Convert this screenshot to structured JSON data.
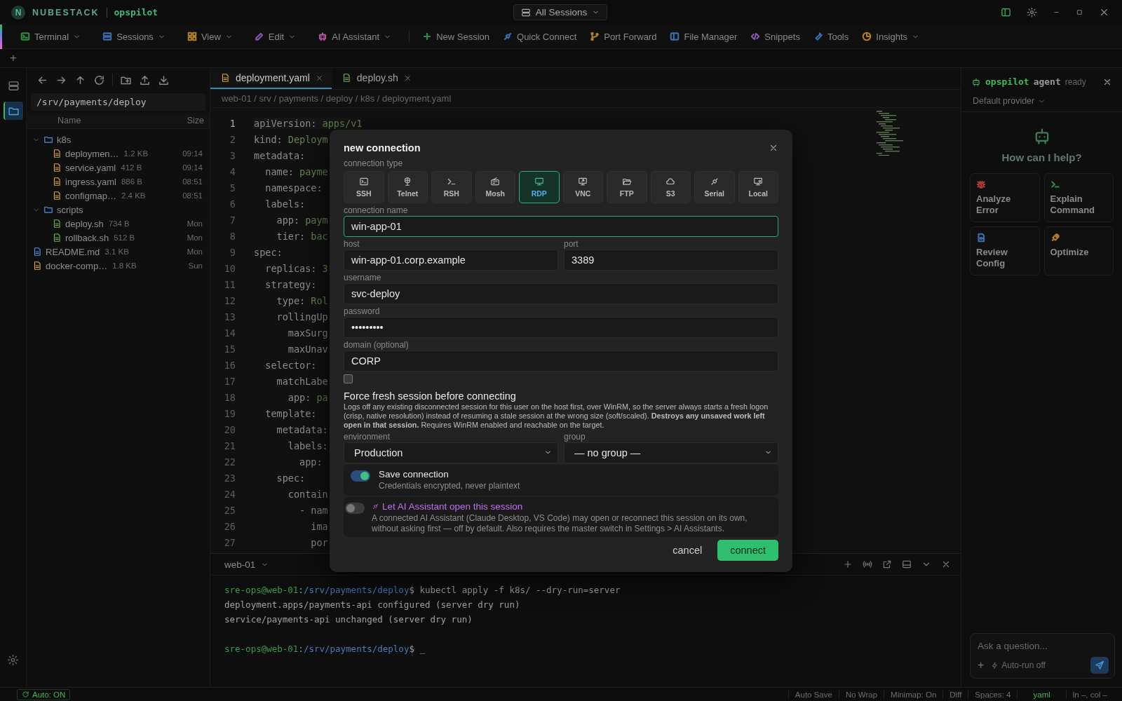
{
  "title_bar": {
    "logo_mark": "N",
    "brand": "NUBESTACK",
    "product": "opspilot",
    "session_switcher": "All Sessions"
  },
  "menu_bar": [
    {
      "label": "Terminal",
      "kind": "menu",
      "dropdown": true,
      "color": "#2e8a45"
    },
    {
      "label": "Sessions",
      "kind": "menu",
      "dropdown": true,
      "color": "#3a6eb0"
    },
    {
      "label": "View",
      "kind": "menu",
      "dropdown": true,
      "color": "#b07e25"
    },
    {
      "label": "Edit",
      "kind": "menu",
      "dropdown": true,
      "color": "#8a56b0"
    },
    {
      "label": "AI Assistant",
      "kind": "menu",
      "dropdown": true,
      "color": "#b055a5"
    },
    {
      "label": "New Session",
      "kind": "action",
      "dropdown": false,
      "color": "#2e8a45"
    },
    {
      "label": "Quick Connect",
      "kind": "action",
      "dropdown": false,
      "color": "#3a6eb0"
    },
    {
      "label": "Port Forward",
      "kind": "action",
      "dropdown": false,
      "color": "#b07e25"
    },
    {
      "label": "File Manager",
      "kind": "action",
      "dropdown": false,
      "color": "#3a6eb0"
    },
    {
      "label": "Snippets",
      "kind": "action",
      "dropdown": false,
      "color": "#8a56b0"
    },
    {
      "label": "Tools",
      "kind": "action",
      "dropdown": false,
      "color": "#3a6eb0"
    },
    {
      "label": "Insights",
      "kind": "action",
      "dropdown": true,
      "color": "#b07e25"
    }
  ],
  "new_tab": "+",
  "activity_bar": [
    {
      "selected": false
    },
    {
      "selected": true
    }
  ],
  "explorer": {
    "path": "/srv/payments/deploy",
    "columns": [
      "Name",
      "Size"
    ],
    "tree": [
      {
        "label": "k8s",
        "kind": "folder",
        "expanded": true,
        "children": [
          {
            "label": "deploymen…",
            "kind": "yaml",
            "size": "1.2 KB",
            "modified": "09:14"
          },
          {
            "label": "service.yaml",
            "kind": "yaml",
            "size": "412 B",
            "modified": "09:14"
          },
          {
            "label": "ingress.yaml",
            "kind": "yaml",
            "size": "886 B",
            "modified": "08:51"
          },
          {
            "label": "configmap…",
            "kind": "yaml",
            "size": "2.4 KB",
            "modified": "08:51"
          }
        ]
      },
      {
        "label": "scripts",
        "kind": "folder",
        "expanded": true,
        "children": [
          {
            "label": "deploy.sh",
            "kind": "shell",
            "size": "734 B",
            "modified": "Mon"
          },
          {
            "label": "rollback.sh",
            "kind": "shell",
            "size": "512 B",
            "modified": "Mon"
          }
        ]
      },
      {
        "label": "README.md",
        "kind": "markdown",
        "size": "3.1 KB",
        "modified": "Mon"
      },
      {
        "label": "docker-comp…",
        "kind": "yaml",
        "size": "1.8 KB",
        "modified": "Sun"
      }
    ]
  },
  "editor": {
    "tabs": [
      {
        "label": "deployment.yaml",
        "kind": "yaml",
        "selected": true
      },
      {
        "label": "deploy.sh",
        "kind": "shell",
        "selected": false
      }
    ],
    "breadcrumb": "web-01 / srv / payments / deploy / k8s / deployment.yaml",
    "lines": [
      {
        "number": "1",
        "key": "apiVersion:",
        "value": "apps/v1",
        "kind": "string",
        "current": true
      },
      {
        "number": "2",
        "key": "kind:",
        "value": "Deploym",
        "kind": "string",
        "current": false
      },
      {
        "number": "3",
        "key": "metadata:",
        "current": false
      },
      {
        "number": "4",
        "key": "  name:",
        "value": "payme",
        "kind": "string",
        "current": false
      },
      {
        "number": "5",
        "key": "  namespace:",
        "current": false
      },
      {
        "number": "6",
        "key": "  labels:",
        "current": false
      },
      {
        "number": "7",
        "key": "    app:",
        "value": "paym",
        "kind": "string",
        "current": false
      },
      {
        "number": "8",
        "key": "    tier:",
        "value": "bac",
        "kind": "string",
        "current": false
      },
      {
        "number": "9",
        "key": "spec:",
        "current": false
      },
      {
        "number": "10",
        "key": "  replicas:",
        "value": "3",
        "kind": "number",
        "current": false
      },
      {
        "number": "11",
        "key": "  strategy:",
        "current": false
      },
      {
        "number": "12",
        "key": "    type:",
        "value": "Rol",
        "kind": "string",
        "current": false
      },
      {
        "number": "13",
        "key": "    rollingUp",
        "current": false
      },
      {
        "number": "14",
        "key": "      maxSurg",
        "current": false
      },
      {
        "number": "15",
        "key": "      maxUnav",
        "current": false
      },
      {
        "number": "16",
        "key": "  selector:",
        "current": false
      },
      {
        "number": "17",
        "key": "    matchLabe",
        "current": false
      },
      {
        "number": "18",
        "key": "      app:",
        "value": "pa",
        "kind": "string",
        "current": false
      },
      {
        "number": "19",
        "key": "  template:",
        "current": false
      },
      {
        "number": "20",
        "key": "    metadata:",
        "current": false
      },
      {
        "number": "21",
        "key": "      labels:",
        "current": false
      },
      {
        "number": "22",
        "key": "        app:",
        "current": false
      },
      {
        "number": "23",
        "key": "    spec:",
        "current": false
      },
      {
        "number": "24",
        "key": "      contain",
        "current": false
      },
      {
        "number": "25",
        "key": "        - nam",
        "current": false
      },
      {
        "number": "26",
        "key": "          ima",
        "current": false
      },
      {
        "number": "27",
        "key": "          por",
        "current": false
      }
    ]
  },
  "terminal": {
    "tab": "web-01",
    "lines": [
      {
        "kind": "prompt",
        "user": "sre-ops@web-01",
        "separator": ":",
        "path": "/srv/payments/deploy",
        "symbol": "$",
        "command": "kubectl apply -f k8s/ --dry-run=server"
      },
      {
        "kind": "output",
        "text": "deployment.apps/payments-api configured (server dry run)"
      },
      {
        "kind": "output",
        "text": "service/payments-api unchanged (server dry run)"
      },
      {
        "kind": "prompt",
        "user": "sre-ops@web-01",
        "separator": ":",
        "path": "/srv/payments/deploy",
        "symbol": "$",
        "command": "_"
      }
    ]
  },
  "agent_panel": {
    "name": "opspilot",
    "role": "agent",
    "status": "ready",
    "provider": "Default provider",
    "heading": "How can I help?",
    "actions": [
      {
        "label": "Analyze Error",
        "color": "#b03a33"
      },
      {
        "label": "Explain Command",
        "color": "#2e8a45"
      },
      {
        "label": "Review Config",
        "color": "#3a6eb0"
      },
      {
        "label": "Optimize",
        "color": "#b07e25"
      }
    ],
    "input": {
      "placeholder": "Ask a question...",
      "attach": "+",
      "auto_run": "Auto-run off"
    }
  },
  "status_bar": {
    "auto": "Auto: ON",
    "items": [
      {
        "label": "Auto Save",
        "kind": "plain"
      },
      {
        "label": "No Wrap",
        "kind": "plain"
      },
      {
        "label": "Minimap: On",
        "kind": "plain"
      },
      {
        "label": "Diff",
        "kind": "plain"
      },
      {
        "label": "Spaces: 4",
        "kind": "plain"
      },
      {
        "label": "yaml",
        "kind": "language"
      },
      {
        "label": "ln –, col –",
        "kind": "plain"
      }
    ]
  },
  "dialog": {
    "title": "new connection",
    "type_label": "connection type",
    "types": [
      {
        "label": "SSH",
        "selected": false
      },
      {
        "label": "Telnet",
        "selected": false
      },
      {
        "label": "RSH",
        "selected": false
      },
      {
        "label": "Mosh",
        "selected": false
      },
      {
        "label": "RDP",
        "selected": true
      },
      {
        "label": "VNC",
        "selected": false
      },
      {
        "label": "FTP",
        "selected": false
      },
      {
        "label": "S3",
        "selected": false
      },
      {
        "label": "Serial",
        "selected": false
      },
      {
        "label": "Local",
        "selected": false
      }
    ],
    "name": {
      "label": "connection name",
      "value": "win-app-01",
      "focused": true
    },
    "host": {
      "label": "host",
      "value": "win-app-01.corp.example",
      "focused": false
    },
    "port": {
      "label": "port",
      "value": "3389",
      "focused": false
    },
    "username": {
      "label": "username",
      "value": "svc-deploy",
      "focused": false
    },
    "password": {
      "label": "password",
      "value": "•••••••••",
      "focused": false
    },
    "domain": {
      "label": "domain (optional)",
      "value": "CORP",
      "focused": false
    },
    "force_fresh": {
      "checked": false,
      "title": "Force fresh session before connecting",
      "description": "Logs off any existing disconnected session for this user on the host first, over WinRM, so the server always starts a fresh logon (crisp, native resolution) instead of resuming a stale session at the wrong size (soft/scaled). **Destroys any unsaved work left open in that session.** Requires WinRM enabled and reachable on the target."
    },
    "environment": {
      "label": "environment",
      "value": "Production"
    },
    "group": {
      "label": "group",
      "value": "— no group —"
    },
    "save": {
      "on": true,
      "title": "Save connection",
      "description": "Credentials encrypted, never plaintext"
    },
    "ai_access": {
      "on": false,
      "title": "Let AI Assistant open this session",
      "description": "A connected AI Assistant (Claude Desktop, VS Code) may open or reconnect this session on its own, without asking first — off by default. Also requires the master switch in Settings > AI Assistants."
    },
    "buttons": [
      {
        "label": "cancel",
        "kind": "secondary"
      },
      {
        "label": "connect",
        "kind": "primary"
      }
    ]
  }
}
